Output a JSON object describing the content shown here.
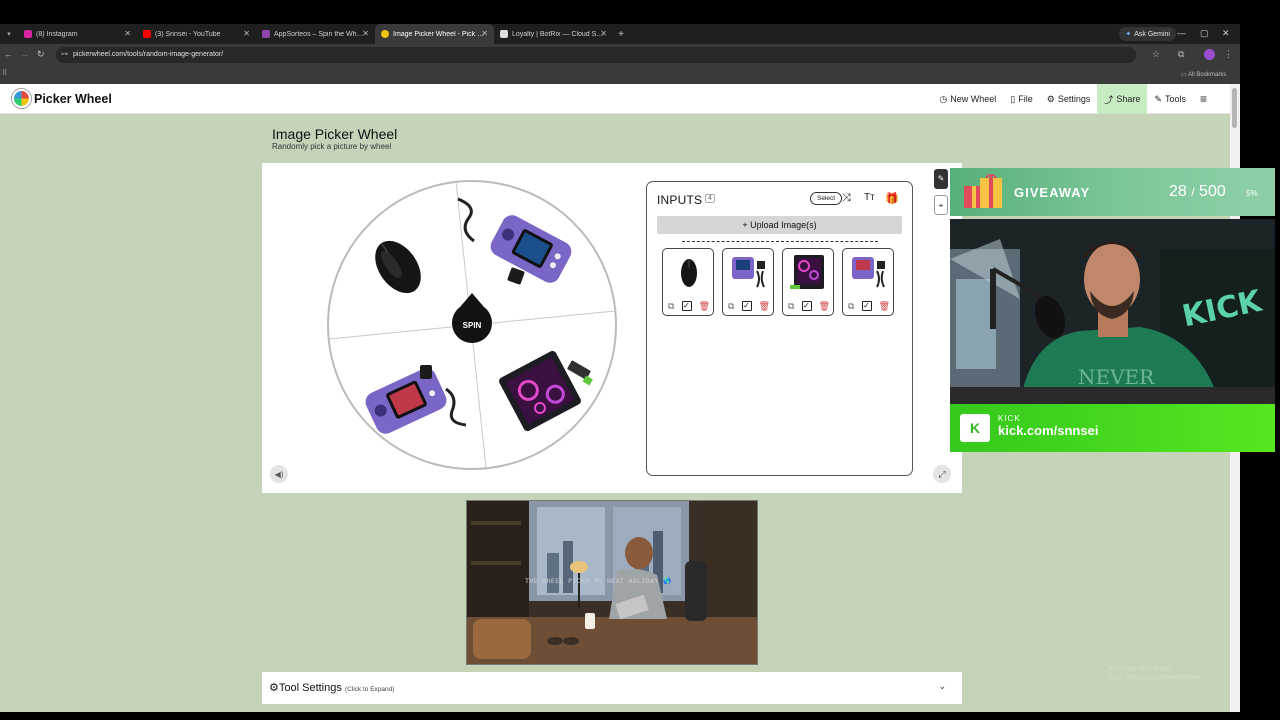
{
  "browser": {
    "tabs": [
      {
        "title": "(8) Instagram",
        "favicon_color": "#d6249f"
      },
      {
        "title": "(3) Snnsei - YouTube",
        "favicon_color": "#ff0000"
      },
      {
        "title": "AppSorteos – Spin the Wheel &",
        "favicon_color": "#8e44ad"
      },
      {
        "title": "Image Picker Wheel - Pick a Ra",
        "favicon_color": "#f1c40f"
      },
      {
        "title": "Loyalty | BotRix — Cloud Stream",
        "favicon_color": "#dddddd"
      }
    ],
    "new_tab": "+",
    "ask_gemini": "Ask Gemini",
    "url": "pickerwheel.com/tools/random-image-generator/",
    "all_bookmarks": "All Bookmarks"
  },
  "site": {
    "logo_text": "Picker Wheel",
    "nav": {
      "new_wheel": "New Wheel",
      "file": "File",
      "settings": "Settings",
      "share": "Share",
      "tools": "Tools"
    }
  },
  "page": {
    "title": "Image Picker Wheel",
    "subtitle": "Randomly pick a picture by wheel"
  },
  "wheel": {
    "spin_label": "SPIN",
    "slices": [
      "mouse",
      "handheld console with cables",
      "gaming pc",
      "handheld console with cables"
    ]
  },
  "inputs": {
    "title": "INPUTS",
    "count": "4",
    "select_label": "Select",
    "upload_label": "+ Upload Image(s)",
    "items": [
      {
        "name": "mouse"
      },
      {
        "name": "handheld console"
      },
      {
        "name": "gaming pc"
      },
      {
        "name": "handheld console"
      }
    ]
  },
  "video": {
    "caption": "THE WHEEL PICKS MY NEXT HOLIDAY 🌎"
  },
  "tool_settings": {
    "label": "Tool Settings",
    "hint": "(Click to Expand)"
  },
  "overlay": {
    "giveaway_label": "GIVEAWAY",
    "giveaway_count": "28",
    "giveaway_total": "500",
    "giveaway_percent": "5%",
    "kick_label": "KICK",
    "kick_url": "kick.com/snnsei"
  },
  "windows_watermark": {
    "line1": "Activate Windows",
    "line2": "Go to Settings to activate Windows."
  },
  "colors": {
    "page_bg": "#c5d3b9",
    "share_bg": "#c8ebc4",
    "kick_green": "#53fc18"
  }
}
